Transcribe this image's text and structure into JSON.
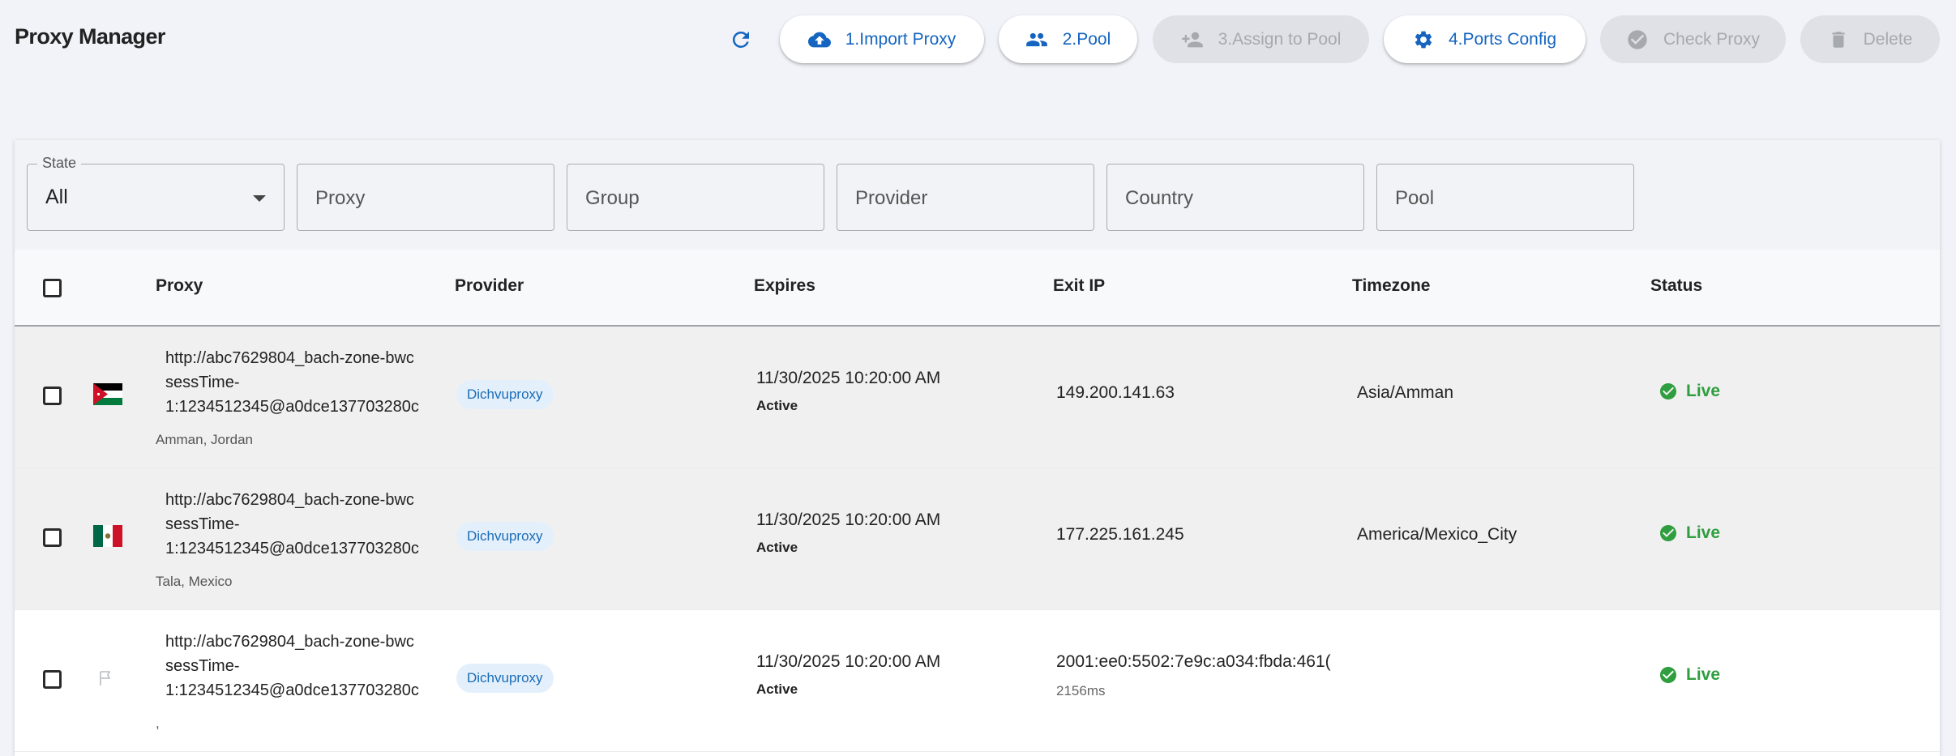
{
  "app": {
    "title": "Proxy Manager"
  },
  "toolbar": {
    "import_label": "1.Import Proxy",
    "pool_label": "2.Pool",
    "assign_label": "3.Assign to Pool",
    "ports_label": "4.Ports Config",
    "check_label": "Check Proxy",
    "delete_label": "Delete",
    "icons": [
      "refresh-icon",
      "cloud-upload-icon",
      "group-icon",
      "person-add-icon",
      "gear-icon",
      "check-circle-icon",
      "trash-icon"
    ]
  },
  "filters": {
    "state_label": "State",
    "state_value": "All",
    "proxy_placeholder": "Proxy",
    "group_placeholder": "Group",
    "provider_placeholder": "Provider",
    "country_placeholder": "Country",
    "pool_placeholder": "Pool"
  },
  "table": {
    "columns": [
      "Proxy",
      "Provider",
      "Expires",
      "Exit IP",
      "Timezone",
      "Status"
    ],
    "rows": [
      {
        "proxy_line1": "http://abc7629804_bach-zone-bwc",
        "proxy_line2": "sessTime-",
        "proxy_line3": "1:1234512345@a0dce137703280c",
        "location": "Amman, Jordan",
        "flag": "jordan-flag",
        "provider": "Dichvuproxy",
        "expires": "11/30/2025 10:20:00 AM",
        "expires_state": "Active",
        "exit_ip": "149.200.141.63",
        "latency": "",
        "timezone": "Asia/Amman",
        "status": "Live"
      },
      {
        "proxy_line1": "http://abc7629804_bach-zone-bwc",
        "proxy_line2": "sessTime-",
        "proxy_line3": "1:1234512345@a0dce137703280c",
        "location": "Tala, Mexico",
        "flag": "mexico-flag",
        "provider": "Dichvuproxy",
        "expires": "11/30/2025 10:20:00 AM",
        "expires_state": "Active",
        "exit_ip": "177.225.161.245",
        "latency": "",
        "timezone": "America/Mexico_City",
        "status": "Live"
      },
      {
        "proxy_line1": "http://abc7629804_bach-zone-bwc",
        "proxy_line2": "sessTime-",
        "proxy_line3": "1:1234512345@a0dce137703280c",
        "location": ",",
        "flag": "unknown-flag",
        "provider": "Dichvuproxy",
        "expires": "11/30/2025 10:20:00 AM",
        "expires_state": "Active",
        "exit_ip": "2001:ee0:5502:7e9c:a034:fbda:461(",
        "latency": "2156ms",
        "timezone": "",
        "status": "Live"
      }
    ]
  },
  "colors": {
    "accent": "#1565c0",
    "live": "#2e9e3e",
    "chip_bg": "#e3f0fc",
    "page_bg": "#f1f3f8"
  }
}
